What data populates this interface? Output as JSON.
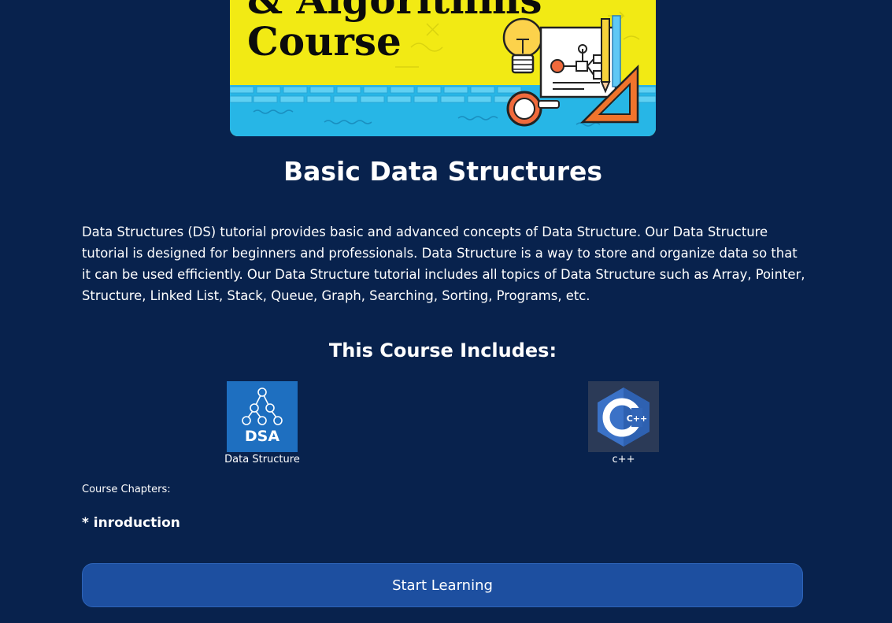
{
  "banner": {
    "line1": "& Algorithms",
    "line2": "Course"
  },
  "course": {
    "title": "Basic Data Structures",
    "description": "Data Structures (DS) tutorial provides basic and advanced concepts of Data Structure. Our Data Structure tutorial is designed for beginners and professionals. Data Structure is a way to store and organize data so that it can be used efficiently. Our Data Structure tutorial includes all topics of Data Structure such as Array, Pointer, Structure, Linked List, Stack, Queue, Graph, Searching, Sorting, Programs, etc.",
    "includes_heading": "This Course Includes:"
  },
  "features": [
    {
      "icon": "dsa-icon",
      "badge": "DSA",
      "caption": "Data Structure"
    },
    {
      "icon": "cpp-icon",
      "badge": "C++",
      "caption": "c++"
    }
  ],
  "chapters": {
    "label": "Course Chapters:",
    "items": [
      "* inroduction"
    ]
  },
  "actions": {
    "start_label": "Start Learning"
  },
  "colors": {
    "background": "#08224d",
    "button": "#1d4fa0",
    "banner": "#f2ea14",
    "dsa_tile": "#1e6fc0",
    "cpp_tile": "#2b3a57"
  }
}
